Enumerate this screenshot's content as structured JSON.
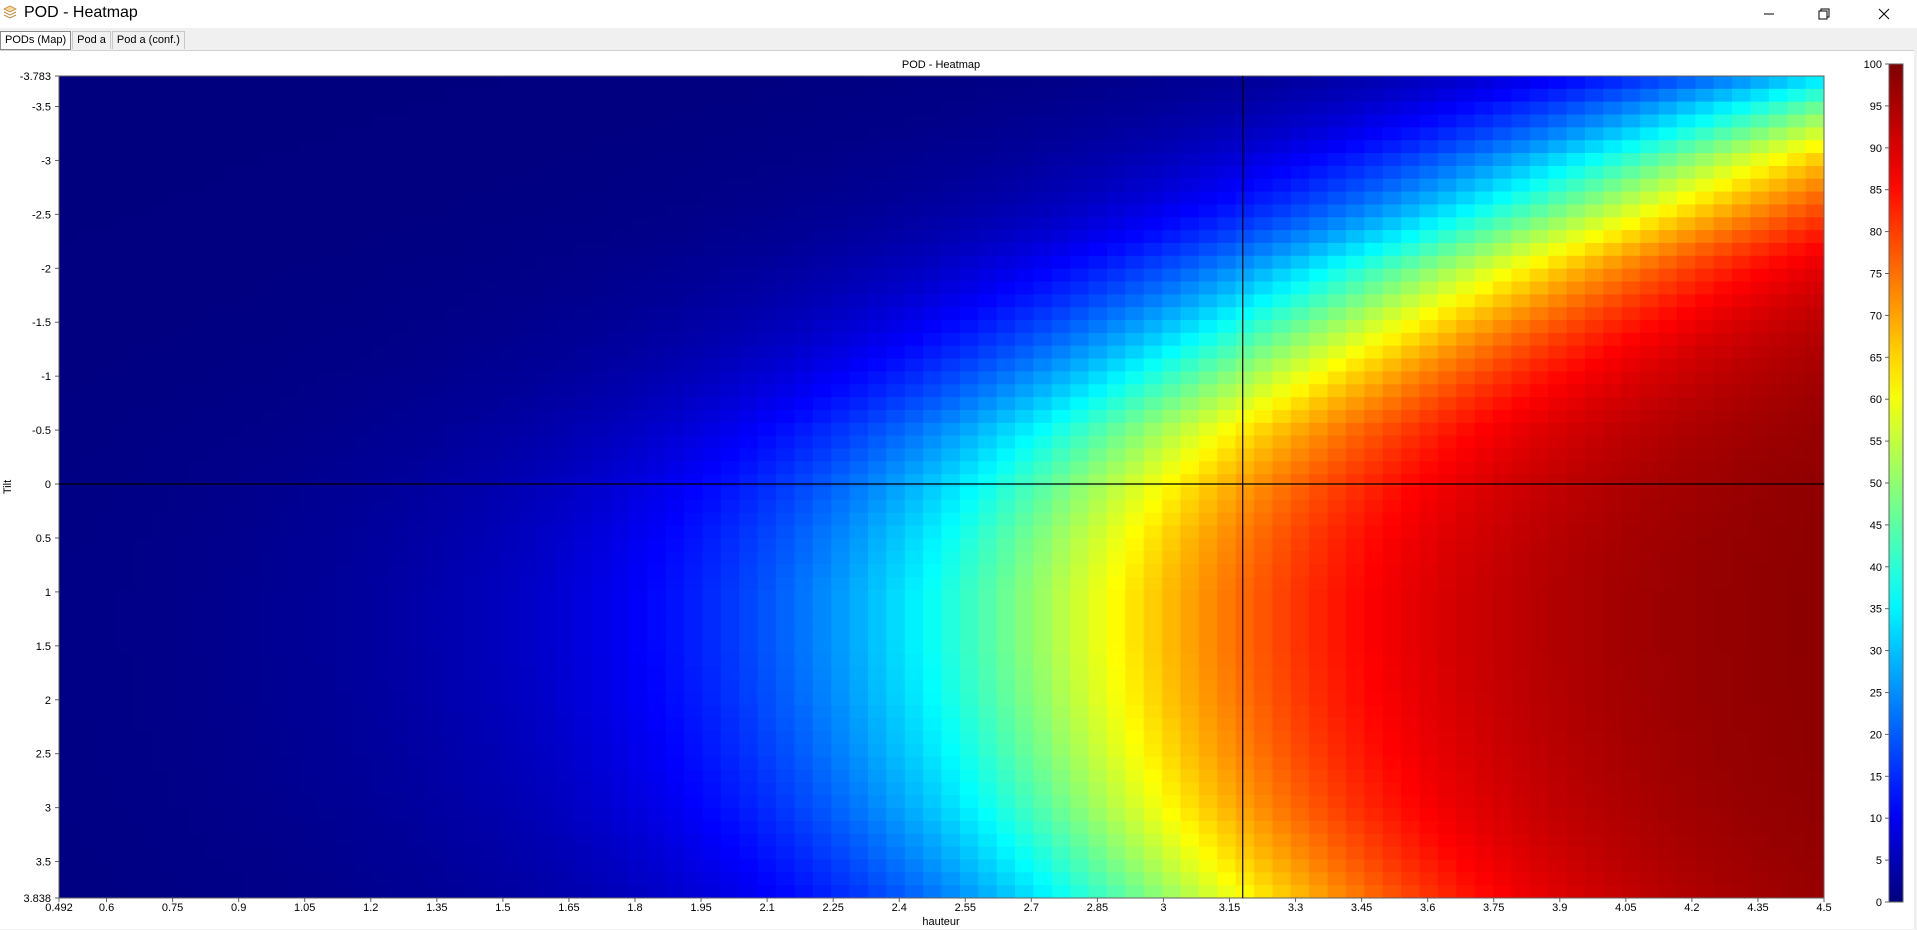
{
  "window": {
    "title": "POD - Heatmap",
    "icon": "stacked-layers-icon",
    "controls": [
      "minimize-icon",
      "restore-icon",
      "close-icon"
    ]
  },
  "tabs": [
    {
      "label": "PODs (Map)",
      "active": true
    },
    {
      "label": "Pod a",
      "active": false
    },
    {
      "label": "Pod a (conf.)",
      "active": false
    }
  ],
  "chart_data": {
    "type": "heatmap",
    "title": "POD - Heatmap",
    "xlabel": "hauteur",
    "ylabel": "Tilt",
    "xlim": [
      0.492,
      4.5
    ],
    "ylim": [
      -3.783,
      3.838
    ],
    "y_axis_direction": "increasing-downward",
    "x_ticks": [
      "0.492",
      "0.6",
      "0.75",
      "0.9",
      "1.05",
      "1.2",
      "1.35",
      "1.5",
      "1.65",
      "1.8",
      "1.95",
      "2.1",
      "2.25",
      "2.4",
      "2.55",
      "2.7",
      "2.85",
      "3",
      "3.15",
      "3.3",
      "3.45",
      "3.6",
      "3.75",
      "3.9",
      "4.05",
      "4.2",
      "4.35",
      "4.5"
    ],
    "y_ticks": [
      "-3.783",
      "-3.5",
      "-3",
      "-2.5",
      "-2",
      "-1.5",
      "-1",
      "-0.5",
      "0",
      "0.5",
      "1",
      "1.5",
      "2",
      "2.5",
      "3",
      "3.5",
      "3.838"
    ],
    "colorbar": {
      "min": 0,
      "max": 100,
      "ticks": [
        "100",
        "95",
        "90",
        "85",
        "80",
        "75",
        "70",
        "65",
        "60",
        "55",
        "50",
        "45",
        "40",
        "35",
        "30",
        "25",
        "20",
        "15",
        "10",
        "5",
        "0"
      ],
      "colormap": "jet",
      "colors": [
        "#00007f",
        "#0000ff",
        "#00ffff",
        "#ffff00",
        "#ff0000",
        "#7f0000"
      ]
    },
    "crosshair": {
      "x": 3.18,
      "y": 0
    },
    "contour_50_percent": {
      "tilt": [
        -3.783,
        -3.5,
        -3,
        -2.5,
        -2,
        -1.5,
        -1,
        -0.5,
        0,
        0.5,
        1,
        1.5,
        2,
        2.5,
        3,
        3.5,
        3.838
      ],
      "hauteur": [
        4.8,
        4.55,
        4.2,
        3.92,
        3.62,
        3.38,
        3.16,
        2.96,
        2.82,
        2.74,
        2.7,
        2.7,
        2.72,
        2.76,
        2.82,
        2.92,
        3.0
      ]
    }
  }
}
